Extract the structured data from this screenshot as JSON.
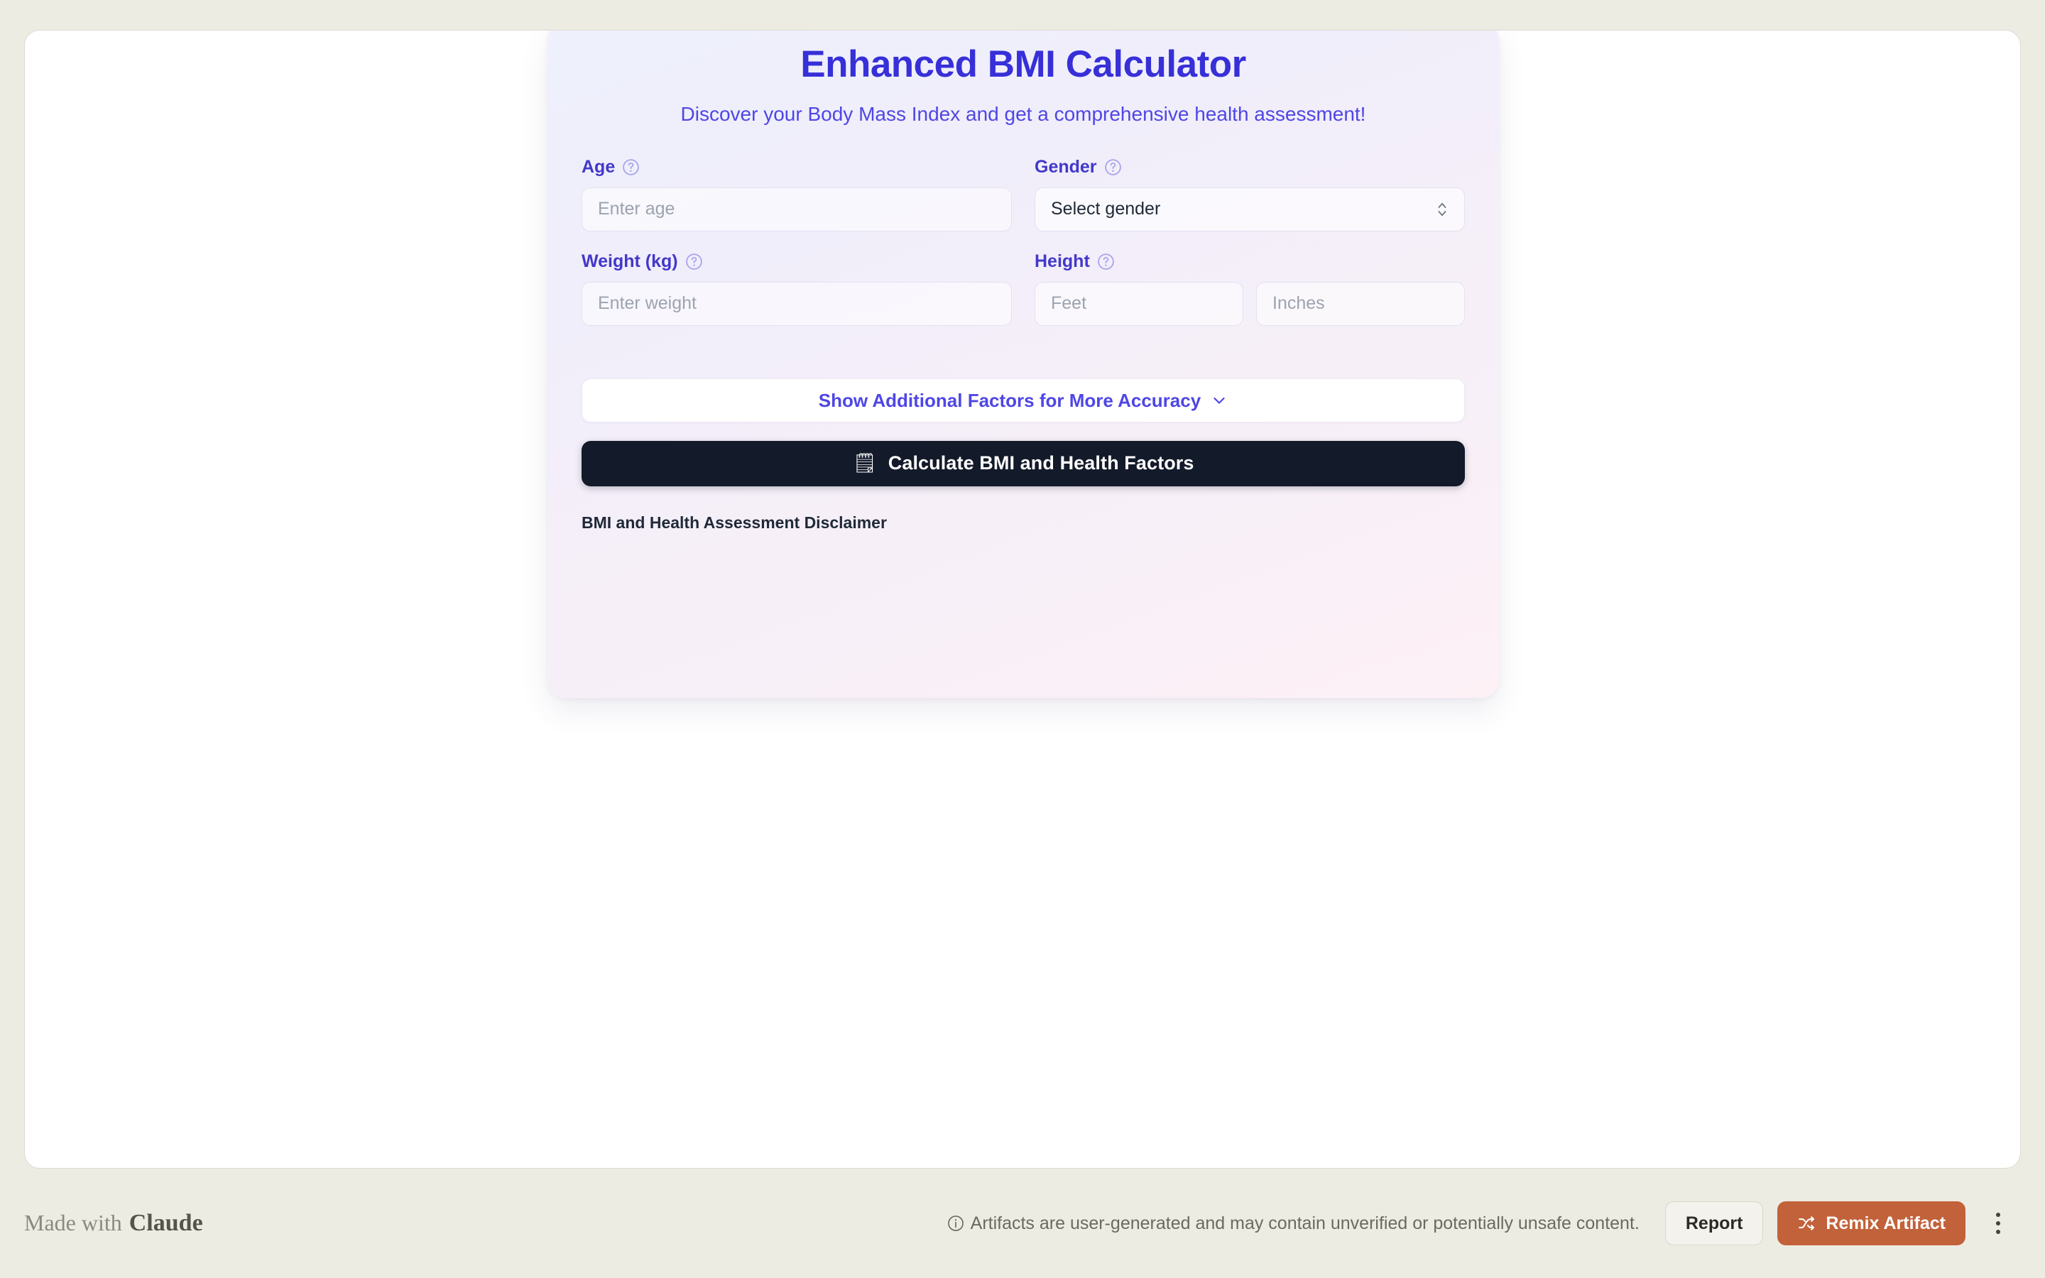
{
  "card": {
    "title": "Enhanced BMI Calculator",
    "subtitle": "Discover your Body Mass Index and get a comprehensive health assessment!",
    "fields": {
      "age": {
        "label": "Age",
        "placeholder": "Enter age",
        "value": "",
        "help_icon": "question-circle-icon"
      },
      "gender": {
        "label": "Gender",
        "selected": "Select gender",
        "help_icon": "question-circle-icon",
        "indicator_icon": "select-chevrons-icon"
      },
      "weight": {
        "label": "Weight (kg)",
        "placeholder": "Enter weight",
        "value": "",
        "help_icon": "question-circle-icon"
      },
      "height": {
        "label": "Height",
        "help_icon": "question-circle-icon",
        "feet_placeholder": "Feet",
        "feet_value": "",
        "inches_placeholder": "Inches",
        "inches_value": ""
      }
    },
    "expand_toggle": {
      "label": "Show Additional Factors for More Accuracy",
      "icon": "chevron-down-icon"
    },
    "calculate_button": {
      "label": "Calculate BMI and Health Factors",
      "icon": "calculator-icon",
      "icon_glyph": "🗒"
    },
    "disclaimer_heading": "BMI and Health Assessment Disclaimer",
    "colors": {
      "title": "#3730d8",
      "subtitle": "#4f46e5",
      "label": "#4338ca",
      "cta_background": "#131a2a",
      "card_gradient_start": "#eef0fc",
      "card_gradient_end": "#fdf1f6"
    }
  },
  "bottom_bar": {
    "made_with_text": "Made with",
    "made_with_brand": "Claude",
    "notice": "Artifacts are user-generated and may contain unverified or potentially unsafe content.",
    "notice_icon": "info-circle-icon",
    "report_label": "Report",
    "remix_label": "Remix Artifact",
    "remix_icon": "shuffle-icon",
    "menu_icon": "kebab-menu-icon",
    "colors": {
      "remix_background": "#c2623a",
      "page_background": "#edece3"
    }
  }
}
